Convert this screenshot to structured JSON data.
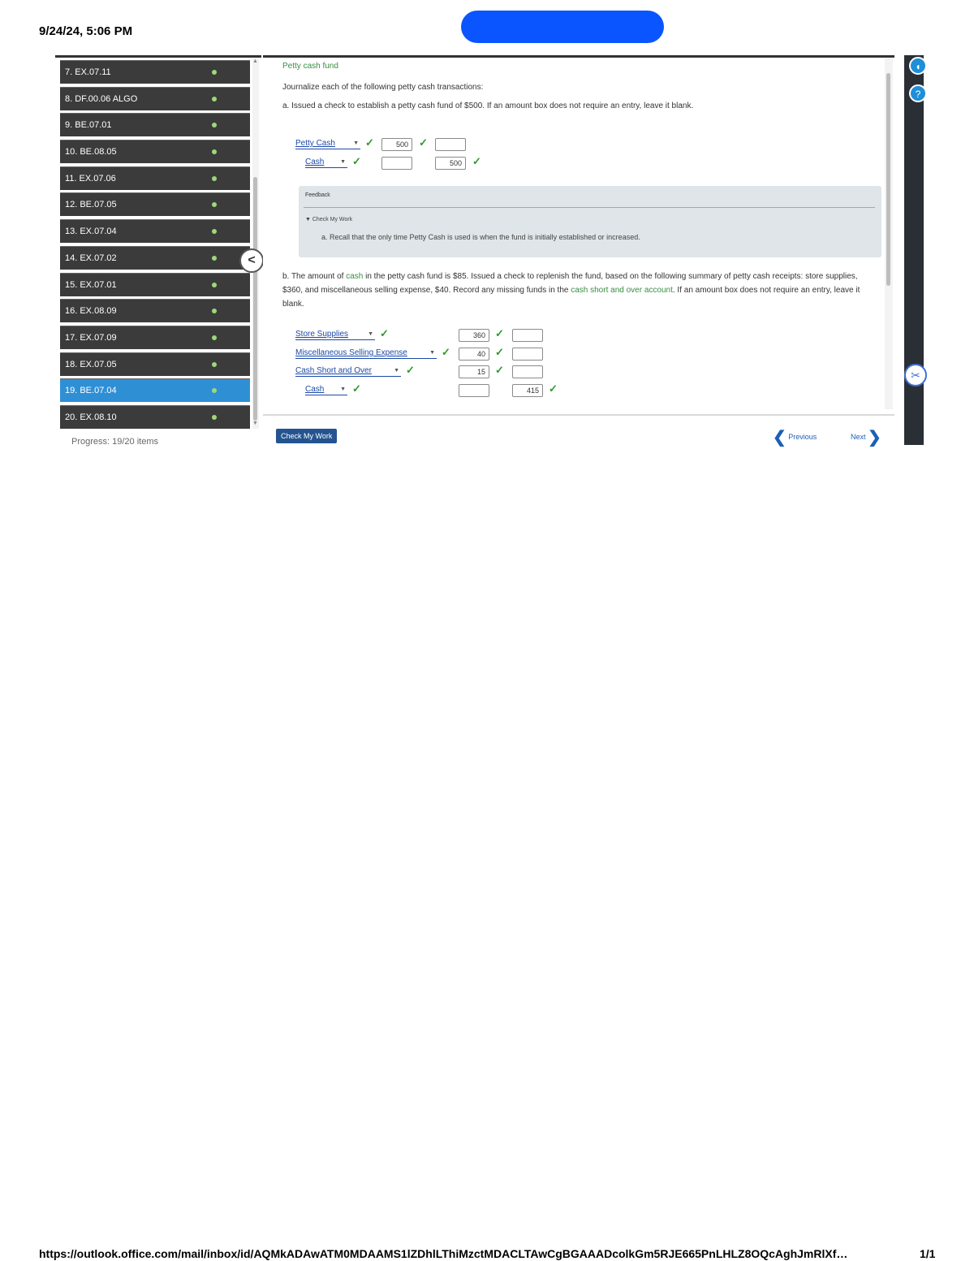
{
  "print_header": {
    "datetime": "9/24/24, 5:06 PM"
  },
  "print_footer": {
    "url": "https://outlook.office.com/mail/inbox/id/AQMkADAwATM0MDAAMS1lZDhlLThiMzctMDACLTAwCgBGAAADcolkGm5RJE665PnLHLZ8OQcAghJmRlXf…",
    "page": "1/1"
  },
  "sidebar": {
    "items": [
      {
        "label": "7. EX.07.11",
        "active": false
      },
      {
        "label": "8. DF.00.06 ALGO",
        "active": false
      },
      {
        "label": "9. BE.07.01",
        "active": false
      },
      {
        "label": "10. BE.08.05",
        "active": false
      },
      {
        "label": "11. EX.07.06",
        "active": false
      },
      {
        "label": "12. BE.07.05",
        "active": false
      },
      {
        "label": "13. EX.07.04",
        "active": false
      },
      {
        "label": "14. EX.07.02",
        "active": false
      },
      {
        "label": "15. EX.07.01",
        "active": false
      },
      {
        "label": "16. EX.08.09",
        "active": false
      },
      {
        "label": "17. EX.07.09",
        "active": false
      },
      {
        "label": "18. EX.07.05",
        "active": false
      },
      {
        "label": "19. BE.07.04",
        "active": true
      },
      {
        "label": "20. EX.08.10",
        "active": false
      }
    ],
    "progress": "Progress: 19/20 items",
    "collapse_glyph": "<"
  },
  "problem": {
    "title": "Petty cash fund",
    "instruction": "Journalize each of the following petty cash transactions:",
    "part_a": {
      "text": "a. Issued a check to establish a petty cash fund of $500. If an amount box does not require an entry, leave it blank.",
      "rows": [
        {
          "account": "Petty Cash",
          "debit": "500",
          "credit": ""
        },
        {
          "account": "Cash",
          "debit": "",
          "credit": "500"
        }
      ]
    },
    "feedback": {
      "title": "Feedback",
      "subtitle": "▼ Check My Work",
      "text": "a. Recall that the only time Petty Cash is used is when the fund is initially established or increased."
    },
    "part_b": {
      "text_1": "b. The amount of ",
      "link_cash": "cash",
      "text_2": " in the petty cash fund is $85. Issued a check to replenish the fund, based on the following summary of petty cash receipts: store supplies, $360, and miscellaneous selling expense, $40. Record any missing funds in the ",
      "link_cso": "cash short and over account",
      "text_3": ". If an amount box does not require an entry, leave it blank.",
      "rows": [
        {
          "account": "Store Supplies",
          "debit": "360",
          "credit": ""
        },
        {
          "account": "Miscellaneous Selling Expense",
          "debit": "40",
          "credit": ""
        },
        {
          "account": "Cash Short and Over",
          "debit": "15",
          "credit": ""
        },
        {
          "account": "Cash",
          "debit": "",
          "credit": "415"
        }
      ]
    }
  },
  "bottom_bar": {
    "check_button": "Check My Work",
    "previous": "Previous",
    "next": "Next"
  },
  "right_bar": {
    "icons": [
      "headset-icon",
      "help-icon",
      "scissors-tool-icon"
    ]
  },
  "colors": {
    "active_item": "#2f8fd5",
    "sidebar_item": "#3b3b3b",
    "check": "#2d9a2d",
    "link": "#1c49a8",
    "redaction": "#0a55ff"
  }
}
